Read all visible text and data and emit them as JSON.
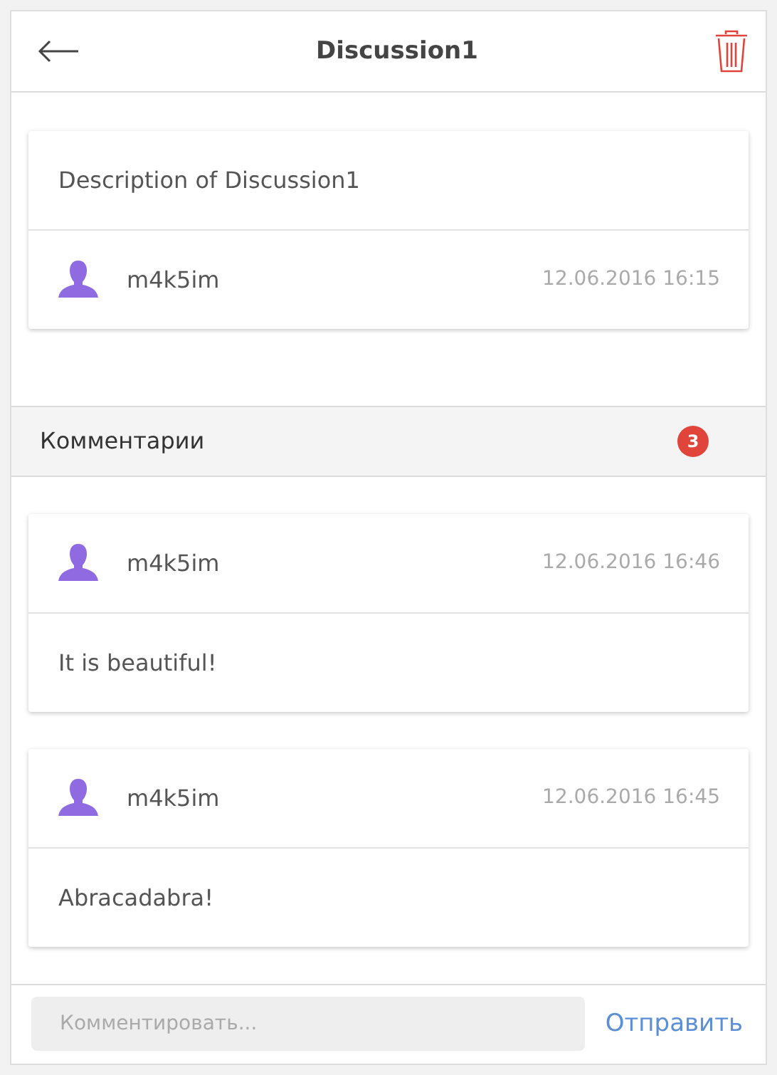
{
  "header": {
    "title": "Discussion1"
  },
  "discussion": {
    "description": "Description of Discussion1",
    "author": "m4k5im",
    "date": "12.06.2016 16:15"
  },
  "comments_section": {
    "title": "Комментарии",
    "count": "3"
  },
  "comments": [
    {
      "author": "m4k5im",
      "date": "12.06.2016 16:46",
      "text": "It is beautiful!"
    },
    {
      "author": "m4k5im",
      "date": "12.06.2016 16:45",
      "text": "Abracadabra!"
    }
  ],
  "composer": {
    "placeholder": "Комментировать...",
    "send": "Отправить"
  }
}
